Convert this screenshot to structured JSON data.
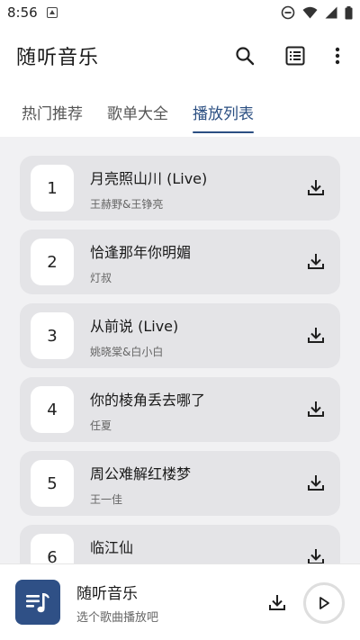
{
  "status_bar": {
    "time": "8:56"
  },
  "app_bar": {
    "title": "随听音乐"
  },
  "tabs": [
    {
      "label": "热门推荐",
      "active": false
    },
    {
      "label": "歌单大全",
      "active": false
    },
    {
      "label": "播放列表",
      "active": true
    }
  ],
  "playlist": [
    {
      "index": "1",
      "title": "月亮照山川 (Live)",
      "artist": "王赫野&王铮亮"
    },
    {
      "index": "2",
      "title": "恰逢那年你明媚",
      "artist": "灯叔"
    },
    {
      "index": "3",
      "title": "从前说 (Live)",
      "artist": "姚晓棠&白小白"
    },
    {
      "index": "4",
      "title": "你的棱角丢去哪了",
      "artist": "任夏"
    },
    {
      "index": "5",
      "title": "周公难解红楼梦",
      "artist": "王一佳"
    },
    {
      "index": "6",
      "title": "临江仙",
      "artist": ""
    }
  ],
  "player": {
    "title": "随听音乐",
    "subtitle": "选个歌曲播放吧"
  },
  "colors": {
    "accent": "#2b4f82",
    "card": "#e4e4e7",
    "list_bg": "#f1f1f3"
  },
  "icons": {
    "status": [
      "notification-icon",
      "dnd-icon",
      "wifi-icon",
      "signal-icon",
      "battery-icon"
    ],
    "app_bar": [
      "search-icon",
      "list-icon",
      "more-vert-icon"
    ],
    "row": "download-icon",
    "player": [
      "music-note-icon",
      "download-icon",
      "play-icon"
    ]
  }
}
